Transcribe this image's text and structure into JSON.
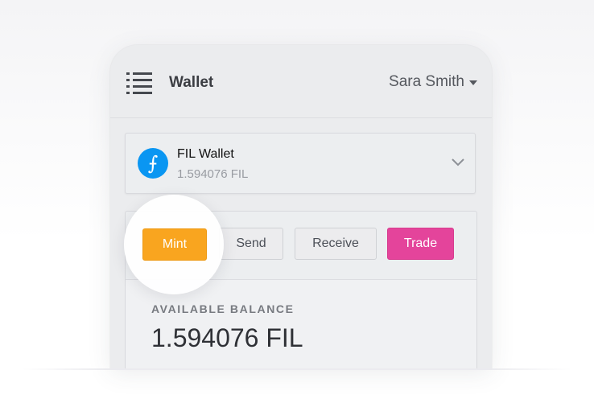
{
  "header": {
    "title": "Wallet",
    "user_name": "Sara Smith",
    "menu_icon": "list-menu-icon",
    "user_caret_icon": "caret-down-icon"
  },
  "wallet": {
    "name": "FIL Wallet",
    "balance": "1.594076 FIL",
    "icon": "filecoin-icon",
    "icon_glyph": "⨍",
    "expand_icon": "chevron-down-icon"
  },
  "actions": {
    "mint": "Mint",
    "send": "Send",
    "receive": "Receive",
    "trade": "Trade"
  },
  "balance": {
    "label": "AVAILABLE BALANCE",
    "value": "1.594076 FIL"
  },
  "colors": {
    "mint": "#f9a51f",
    "trade": "#e4449b",
    "filecoin": "#0a96f2"
  }
}
